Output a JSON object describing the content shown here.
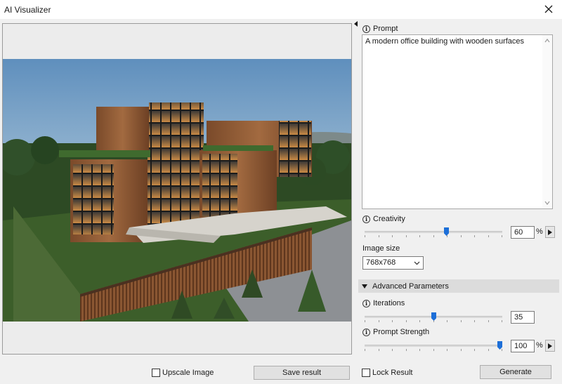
{
  "window": {
    "title": "AI Visualizer",
    "close_icon": "close-icon"
  },
  "prompt": {
    "label": "Prompt",
    "value": "A modern office building with wooden surfaces"
  },
  "creativity": {
    "label": "Creativity",
    "value": "60",
    "unit": "%",
    "level": 0.6
  },
  "image_size": {
    "label": "Image size",
    "selected": "768x768"
  },
  "advanced": {
    "label": "Advanced Parameters",
    "expanded": true
  },
  "iterations": {
    "label": "Iterations",
    "value": "35",
    "level": 0.5
  },
  "prompt_strength": {
    "label": "Prompt Strength",
    "value": "100",
    "unit": "%",
    "level": 1.0
  },
  "footer": {
    "upscale_label": "Upscale Image",
    "save_label": "Save result",
    "lock_label": "Lock Result",
    "generate_label": "Generate"
  },
  "colors": {
    "accent": "#1d6fd8",
    "section_bg": "#dcdcdc"
  }
}
